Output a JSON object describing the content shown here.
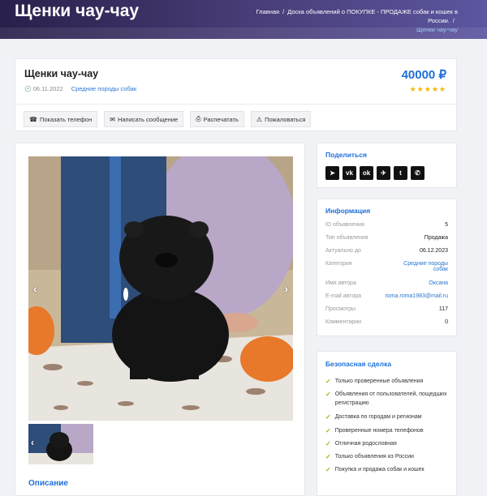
{
  "header": {
    "title": "Щенки чау-чау",
    "breadcrumbs": [
      "Главная",
      "Доска объявлений о ПОКУПКЕ - ПРОДАЖЕ собак и кошек в России.",
      "Щенки чау-чау"
    ]
  },
  "ad": {
    "title": "Щенки чау-чау",
    "date": "06.11.2022",
    "category": "Средние породы собак",
    "price": "40000 ₽",
    "rating": 5,
    "stars": "★★★★★",
    "actions": [
      "Показать телефон",
      "Написать сообщение",
      "Распечатать",
      "Пожаловаться"
    ]
  },
  "gallery": {
    "description_title": "Описание"
  },
  "share": {
    "title": "Поделиться",
    "networks": [
      "telegram-send",
      "vk",
      "odnoklassniki",
      "telegram",
      "twitter",
      "whatsapp"
    ]
  },
  "info": {
    "title": "Информация",
    "rows": [
      {
        "label": "ID объявления",
        "value": "5"
      },
      {
        "label": "Тип объявления",
        "value": "Продажа"
      },
      {
        "label": "Актуально до",
        "value": "06.12.2023"
      },
      {
        "label": "Категория",
        "value": "Средние породы собак"
      },
      {
        "label": "Имя автора",
        "value": "Оксана"
      },
      {
        "label": "E-mail автора",
        "value": "roma.roma1983@mail.ru"
      },
      {
        "label": "Просмотры",
        "value": "117"
      },
      {
        "label": "Комментарии",
        "value": "0"
      }
    ]
  },
  "safe": {
    "title": "Безопасная сделка",
    "items": [
      "Только проверенные объявления",
      "Объявления от пользователей, пощедших регистрацию",
      "Доставка по городам и регионам",
      "Проверенные номера телефонов",
      "Отличная родословная",
      "Только объявления из России",
      "Покупка и продажа собак и кошек"
    ]
  },
  "colors": {
    "accent": "#1e6fd9",
    "star": "#f5b800",
    "check": "#8bbf1a"
  }
}
